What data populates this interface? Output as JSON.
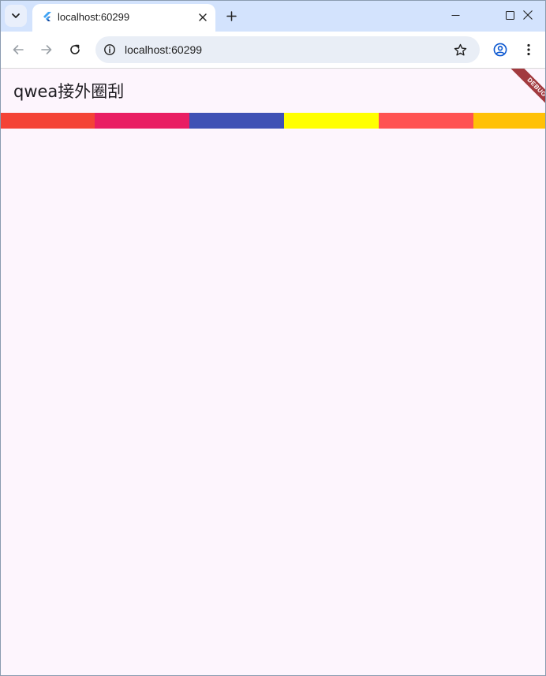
{
  "browser": {
    "tab": {
      "title": "localhost:60299",
      "favicon": "flutter-icon"
    },
    "address_bar": {
      "url": "localhost:60299"
    },
    "icons": {
      "tab_search": "chevron-down-icon",
      "new_tab": "plus-icon",
      "back": "arrow-left-icon",
      "forward": "arrow-right-icon",
      "reload": "reload-icon",
      "site_info": "info-icon",
      "bookmark": "star-icon",
      "profile": "profile-icon",
      "menu": "kebab-menu-icon",
      "minimize": "minimize-icon",
      "maximize": "maximize-icon",
      "close": "close-icon"
    }
  },
  "app": {
    "title": "qwea接外圈刮",
    "debug_banner": "DEBUG",
    "color_strip": [
      "#f44336",
      "#e91e63",
      "#3f51b5",
      "#ffff00",
      "#ff5252",
      "#ffc107"
    ]
  }
}
